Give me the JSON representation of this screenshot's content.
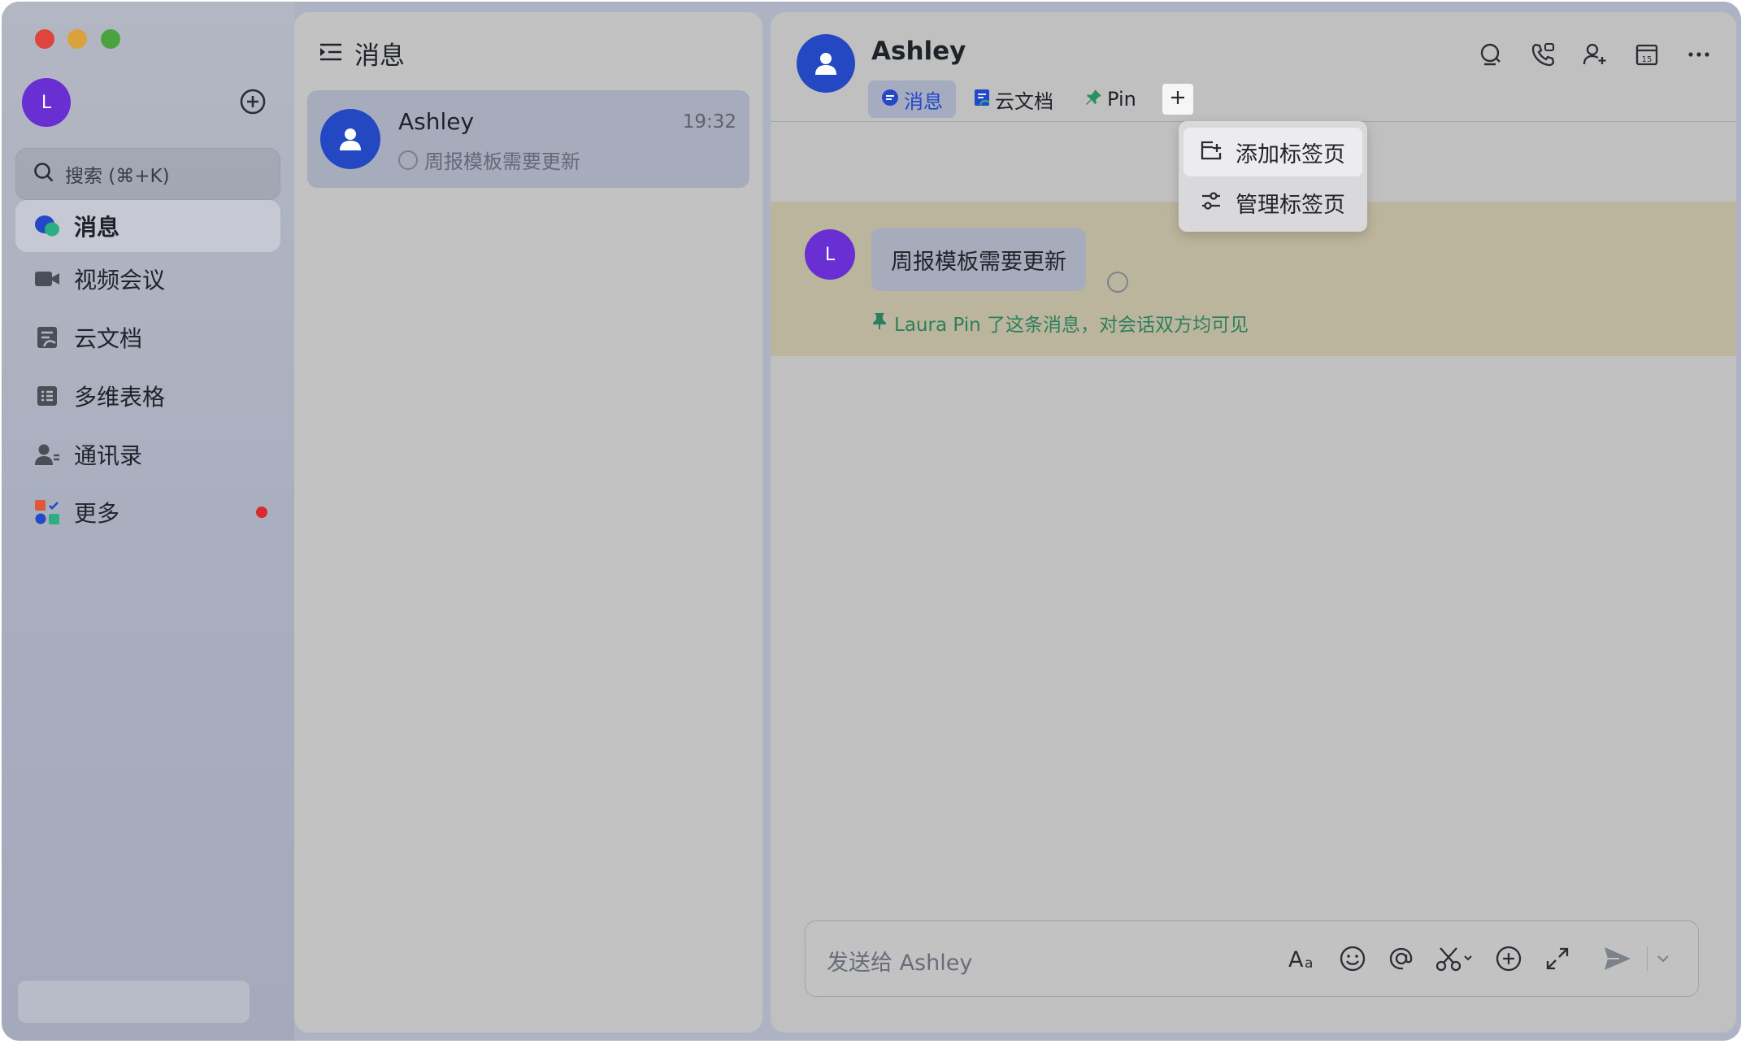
{
  "user": {
    "avatar_initial": "L",
    "avatar_color": "#6a2fd2"
  },
  "sidebar": {
    "search_placeholder": "搜索 (⌘+K)",
    "items": [
      {
        "label": "消息",
        "icon": "message-icon",
        "active": true
      },
      {
        "label": "视频会议",
        "icon": "video-icon"
      },
      {
        "label": "云文档",
        "icon": "docs-icon"
      },
      {
        "label": "多维表格",
        "icon": "table-icon"
      },
      {
        "label": "通讯录",
        "icon": "contacts-icon"
      },
      {
        "label": "更多",
        "icon": "apps-icon",
        "badge_dot": true
      }
    ]
  },
  "list": {
    "title": "消息",
    "conversations": [
      {
        "name": "Ashley",
        "time": "19:32",
        "preview": "周报模板需要更新",
        "avatar_color": "#2448c2"
      }
    ]
  },
  "chat": {
    "name": "Ashley",
    "tabs": [
      {
        "label": "消息",
        "icon": "message-icon",
        "active": true
      },
      {
        "label": "云文档",
        "icon": "docs-icon"
      },
      {
        "label": "Pin",
        "icon": "pin-icon"
      }
    ],
    "header_icons": [
      "search-icon",
      "phone-icon",
      "add-member-icon",
      "calendar-icon",
      "more-icon"
    ],
    "dropdown": [
      {
        "label": "添加标签页",
        "icon": "add-tab-icon"
      },
      {
        "label": "管理标签页",
        "icon": "settings-sliders-icon"
      }
    ],
    "messages": [
      {
        "avatar_initial": "L",
        "text": "周报模板需要更新",
        "pin_note": "Laura Pin 了这条消息，对会话双方均可见"
      }
    ],
    "composer": {
      "placeholder": "发送给 Ashley",
      "tools": [
        "text-format-icon",
        "emoji-icon",
        "mention-icon",
        "screenshot-icon",
        "plus-icon",
        "expand-icon",
        "send-icon"
      ]
    },
    "calendar_day": "15",
    "accent_color": "#2548c9",
    "pin_note_color": "#2c7f5c",
    "calendar_icon_number": "15"
  }
}
